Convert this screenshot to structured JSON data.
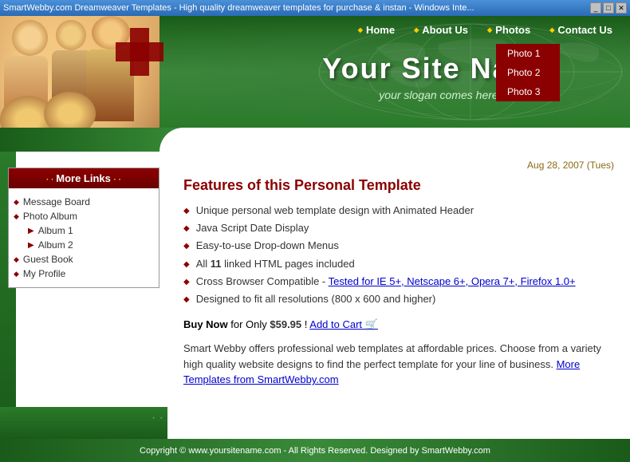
{
  "titlebar": {
    "title": "SmartWebby.com Dreamweaver Templates - High quality dreamweaver templates for purchase & instan - Windows Inte...",
    "controls": [
      "_",
      "□",
      "✕"
    ]
  },
  "nav": {
    "items": [
      {
        "label": "Home",
        "id": "home"
      },
      {
        "label": "About Us",
        "id": "about"
      },
      {
        "label": "Photos",
        "id": "photos",
        "has_dropdown": true
      },
      {
        "label": "Contact Us",
        "id": "contact"
      }
    ],
    "dropdown_photos": [
      {
        "label": "Photo 1"
      },
      {
        "label": "Photo 2"
      },
      {
        "label": "Photo 3"
      }
    ]
  },
  "header": {
    "site_title": "Your Site Name",
    "site_slogan": "your slogan comes here"
  },
  "sidebar": {
    "box_title": "More Links",
    "links": [
      {
        "label": "Message Board",
        "type": "diamond",
        "indent": 0
      },
      {
        "label": "Photo Album",
        "type": "diamond",
        "indent": 0
      },
      {
        "label": "Album 1",
        "type": "arrow",
        "indent": 1
      },
      {
        "label": "Album 2",
        "type": "arrow",
        "indent": 1
      },
      {
        "label": "Guest Book",
        "type": "diamond",
        "indent": 0
      },
      {
        "label": "My Profile",
        "type": "diamond",
        "indent": 0
      }
    ]
  },
  "content": {
    "date": "Aug 28, 2007 (Tues)",
    "title": "Features of this Personal Template",
    "features": [
      {
        "text": "Unique personal web template design with Animated Header"
      },
      {
        "text": "Java Script Date Display"
      },
      {
        "text": "Easy-to-use Drop-down Menus"
      },
      {
        "text": "All 11 linked HTML pages included",
        "bold_part": "11"
      },
      {
        "text": "Cross Browser Compatible - Tested for IE 5+, Netscape 6+, Opera 7+, Firefox 1.0+",
        "has_link": true
      },
      {
        "text": "Designed to fit all resolutions (800 x 600 and higher)"
      }
    ],
    "buy_label": "Buy Now",
    "buy_text": " for Only ",
    "price": "$59.95",
    "add_cart": "! Add to Cart",
    "description": "Smart Webby offers professional web templates at affordable prices. Choose from a variety high quality website designs to find the perfect template for your line of business.",
    "more_link": "More Templates from SmartWebby.com"
  },
  "footer": {
    "text": "Copyright © www.yoursitename.com - All Rights Reserved. Designed by SmartWebby.com"
  }
}
